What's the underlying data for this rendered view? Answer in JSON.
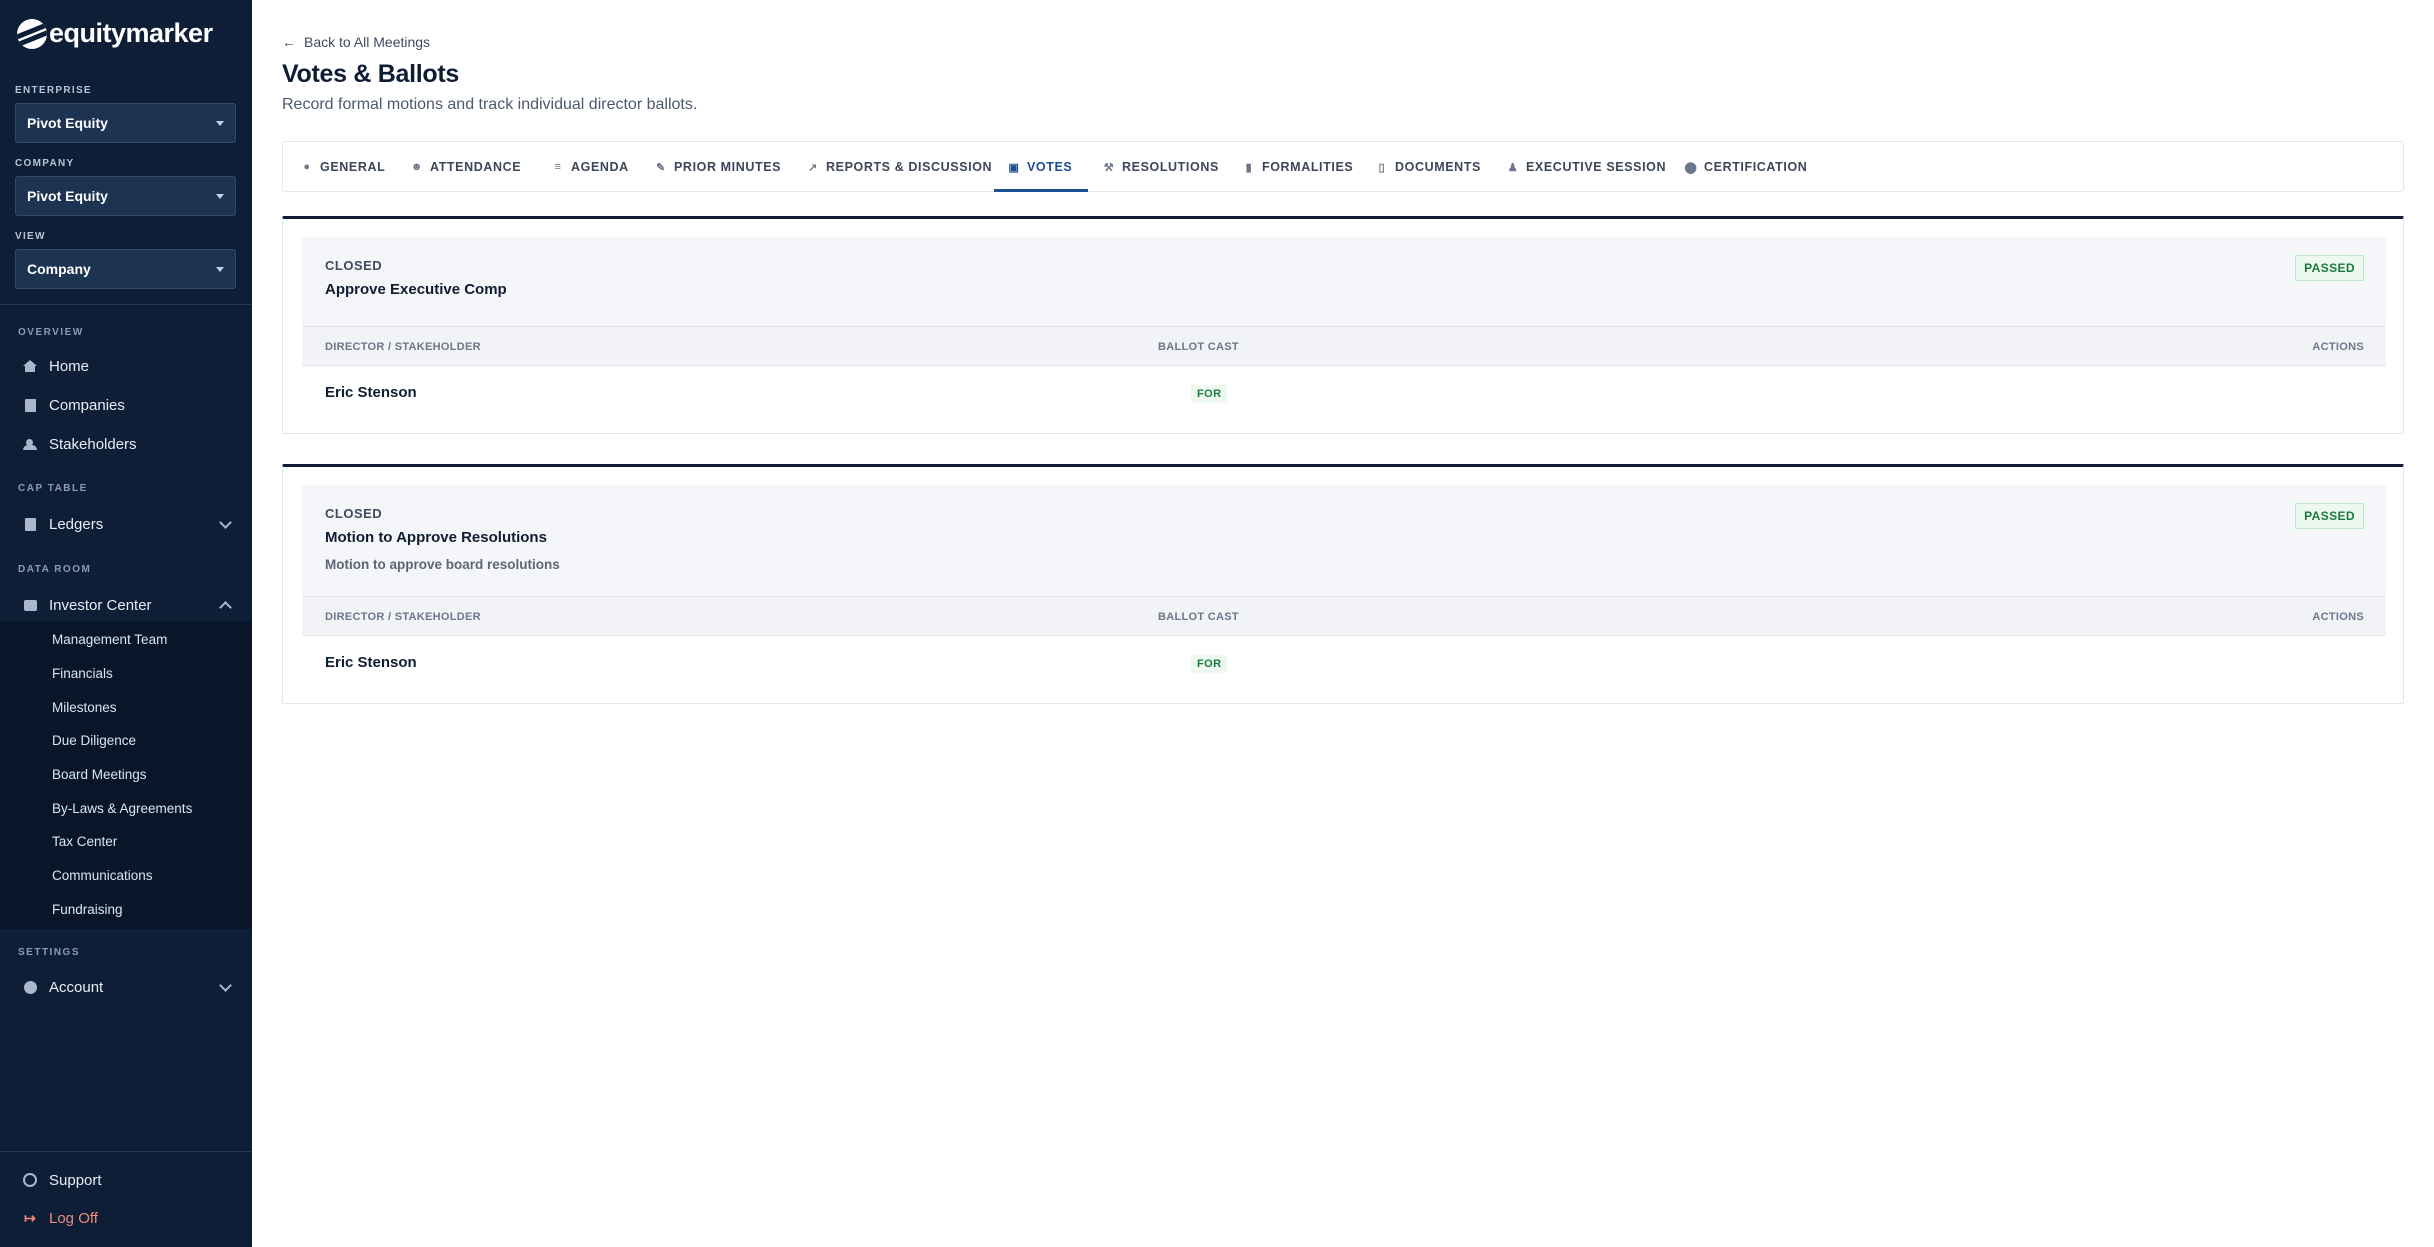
{
  "app": {
    "brand": "equitymarker"
  },
  "sidebar": {
    "enterprise": {
      "label": "ENTERPRISE",
      "value": "Pivot Equity"
    },
    "company": {
      "label": "COMPANY",
      "value": "Pivot Equity"
    },
    "view": {
      "label": "VIEW",
      "value": "Company"
    },
    "overview_label": "OVERVIEW",
    "home": "Home",
    "companies": "Companies",
    "stakeholders": "Stakeholders",
    "cap_table_label": "CAP TABLE",
    "ledgers": "Ledgers",
    "data_room_label": "DATA ROOM",
    "investor_center": "Investor Center",
    "sub_items": [
      "Management Team",
      "Financials",
      "Milestones",
      "Due Diligence",
      "Board Meetings",
      "By-Laws & Agreements",
      "Tax Center",
      "Communications",
      "Fundraising"
    ],
    "settings_label": "SETTINGS",
    "account": "Account",
    "support": "Support",
    "logoff": "Log Off"
  },
  "header": {
    "back": "Back to All Meetings",
    "title": "Votes & Ballots",
    "subtitle": "Record formal motions and track individual director ballots."
  },
  "tabs": [
    {
      "label": "GENERAL",
      "icon": "info-icon"
    },
    {
      "label": "ATTENDANCE",
      "icon": "users-icon"
    },
    {
      "label": "AGENDA",
      "icon": "list-icon"
    },
    {
      "label": "PRIOR MINUTES",
      "icon": "file-check-icon"
    },
    {
      "label": "REPORTS & DISCUSSION",
      "icon": "chart-line-icon"
    },
    {
      "label": "VOTES",
      "icon": "ballot-box-icon",
      "active": true
    },
    {
      "label": "RESOLUTIONS",
      "icon": "gavel-icon"
    },
    {
      "label": "FORMALITIES",
      "icon": "clipboard-icon"
    },
    {
      "label": "DOCUMENTS",
      "icon": "file-icon"
    },
    {
      "label": "EXECUTIVE SESSION",
      "icon": "user-tie-icon"
    },
    {
      "label": "CERTIFICATION",
      "icon": "seal-icon"
    }
  ],
  "table_headers": {
    "director": "DIRECTOR / STAKEHOLDER",
    "ballot": "BALLOT CAST",
    "actions": "ACTIONS"
  },
  "votes": [
    {
      "status": "CLOSED",
      "title": "Approve Executive Comp",
      "description": "",
      "result": "PASSED",
      "ballots": [
        {
          "name": "Eric Stenson",
          "vote": "FOR"
        }
      ]
    },
    {
      "status": "CLOSED",
      "title": "Motion to Approve Resolutions",
      "description": "Motion to approve board resolutions",
      "result": "PASSED",
      "ballots": [
        {
          "name": "Eric Stenson",
          "vote": "FOR"
        }
      ]
    }
  ],
  "colors": {
    "sidebar_bg": "#0d1e36",
    "accent": "#1b4f92",
    "success": "#1a7a3a",
    "logoff": "#f08a7a"
  }
}
